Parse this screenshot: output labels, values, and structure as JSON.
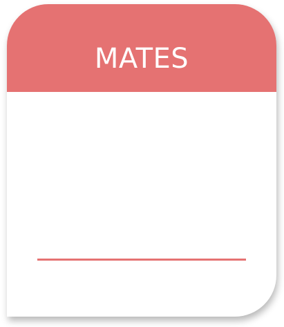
{
  "label": {
    "title": "MATES"
  },
  "colors": {
    "accent": "#e57272",
    "background": "#ffffff",
    "title_text": "#ffffff"
  }
}
